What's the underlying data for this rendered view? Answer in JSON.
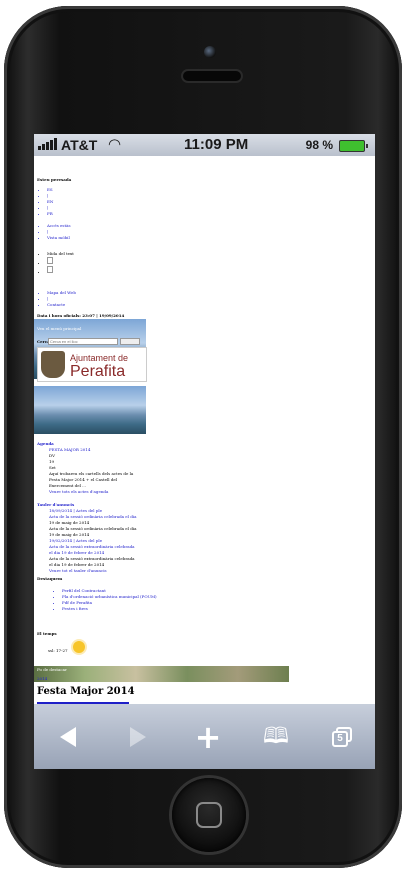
{
  "status": {
    "carrier": "AT&T",
    "time": "11:09 PM",
    "battery": "98 %"
  },
  "page": {
    "you_are_here": "Esteu peresada",
    "lang": [
      "ES",
      "|",
      "EN",
      "|",
      "FR"
    ],
    "nav1": [
      "Accés estàs",
      "|",
      "Vista mòbil"
    ],
    "size_label": "Mida del text",
    "nav2": [
      "Mapa del Web",
      "|",
      "Contacte"
    ],
    "date_line": "Data i hora oficials: 23:07 | 19/09/2014",
    "top_link": "Veu el menú principal",
    "search_label": "Cerca",
    "search_placeholder": "Cerca en el lloc",
    "logo_line1": "Ajuntament de",
    "logo_line2": "Perafita",
    "agenda_title": "Agenda",
    "agenda_items": [
      "FESTA MAJOR 2014",
      "DV",
      "19",
      "Set",
      "Aquí trobareu els cartells dels actes de la",
      "Festa Major 2014 + el Castell del",
      "Exercement del ...",
      "Veure tots els actes d'agenda"
    ],
    "tauler_title": "Tauler d'anuncis",
    "tauler_items": [
      "18/09/2014 | Actes del ple",
      "Acta de la sessió ordinària celebrada el dia",
      "19 de maig de 2014",
      "Acta de la sessió ordinària celebrada el dia",
      "19 de maig de 2014",
      "19/02/2014 | Actes del ple",
      "Acta de la sessió extraordinària celebrada",
      "el dia 19 de febrer de 2014",
      "Acta de la sessió extraordinària celebrada",
      "el dia 19 de febrer de 2014",
      "Veure tot el tauler d'anuncis"
    ],
    "destaquem_title": "Destaquem",
    "destaquem_items": [
      "Perfil del Contractant",
      "Pla d'ordenació urbanística municipal (POUM)",
      "Pdf de Perafita",
      "Festes i fires"
    ],
    "weather_title": "El temps",
    "weather_text": "ssl: 17-27",
    "photo_caption": "Fo de destacar",
    "year": "2014",
    "heading": "Festa Major 2014"
  },
  "toolbar": {
    "tabs_count": "5"
  }
}
